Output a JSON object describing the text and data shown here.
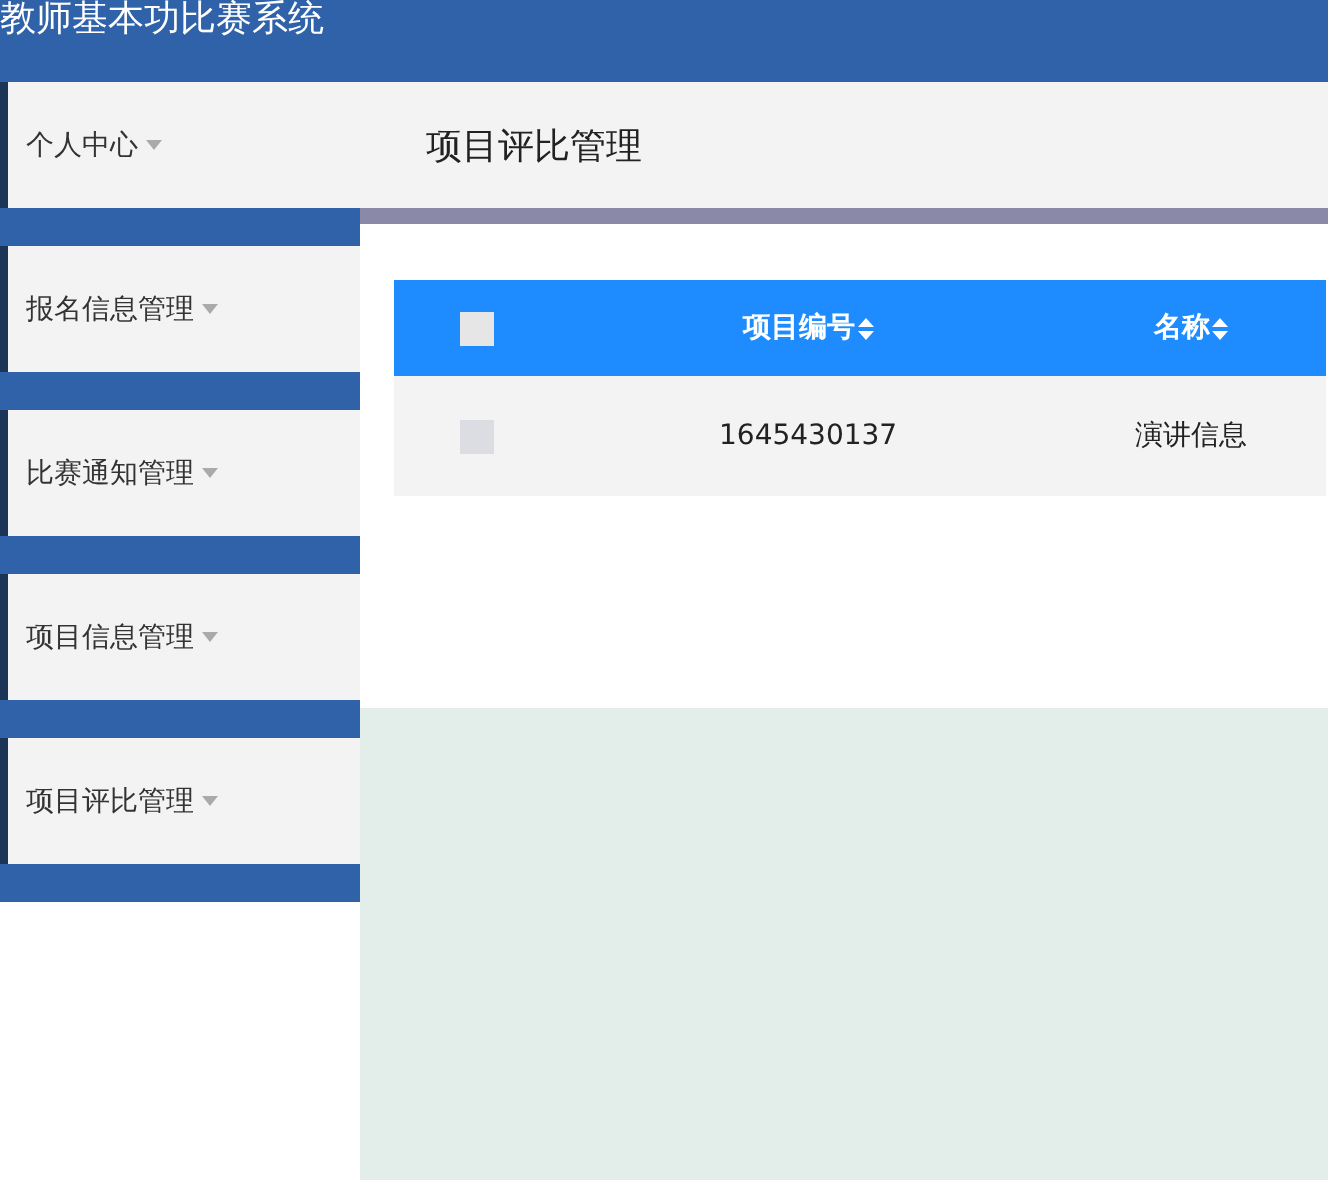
{
  "app": {
    "title": "教师基本功比赛系统"
  },
  "sidebar": {
    "items": [
      {
        "label": "个人中心",
        "expanded": false
      },
      {
        "label": "报名信息管理",
        "expanded": false
      },
      {
        "label": "比赛通知管理",
        "expanded": false
      },
      {
        "label": "项目信息管理",
        "expanded": false
      },
      {
        "label": "项目评比管理",
        "expanded": false
      }
    ]
  },
  "page": {
    "title": "项目评比管理"
  },
  "table": {
    "all_checked": false,
    "columns": [
      {
        "label": "项目编号",
        "sortable": true
      },
      {
        "label": "名称",
        "sortable": true
      }
    ],
    "rows": [
      {
        "checked": false,
        "cells": [
          "1645430137",
          "演讲信息"
        ]
      }
    ]
  }
}
